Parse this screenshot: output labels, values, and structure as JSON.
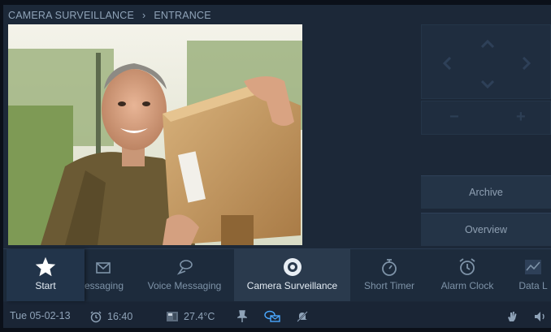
{
  "breadcrumb": {
    "section": "CAMERA SURVEILLANCE",
    "separator": "›",
    "page": "ENTRANCE"
  },
  "camera_controls": {
    "up": "up-arrow",
    "down": "down-arrow",
    "left": "left-arrow",
    "right": "right-arrow",
    "zoom_out": "−",
    "zoom_in": "+"
  },
  "side_buttons": {
    "archive": "Archive",
    "overview": "Overview"
  },
  "dock": {
    "start": "Start",
    "items": [
      {
        "label": "essaging",
        "icon": "envelope-icon"
      },
      {
        "label": "Voice Messaging",
        "icon": "voice-message-icon"
      },
      {
        "label": "Camera Surveillance",
        "icon": "camera-icon"
      },
      {
        "label": "Short Timer",
        "icon": "stopwatch-icon"
      },
      {
        "label": "Alarm Clock",
        "icon": "alarm-clock-icon"
      },
      {
        "label": "Data L",
        "icon": "data-log-icon"
      }
    ]
  },
  "status": {
    "date": "Tue 05-02-13",
    "time": "16:40",
    "temperature": "27.4°C"
  },
  "colors": {
    "background": "#1c2838",
    "active": "#2a3a4d",
    "accent_icon": "#4aa8ff"
  }
}
